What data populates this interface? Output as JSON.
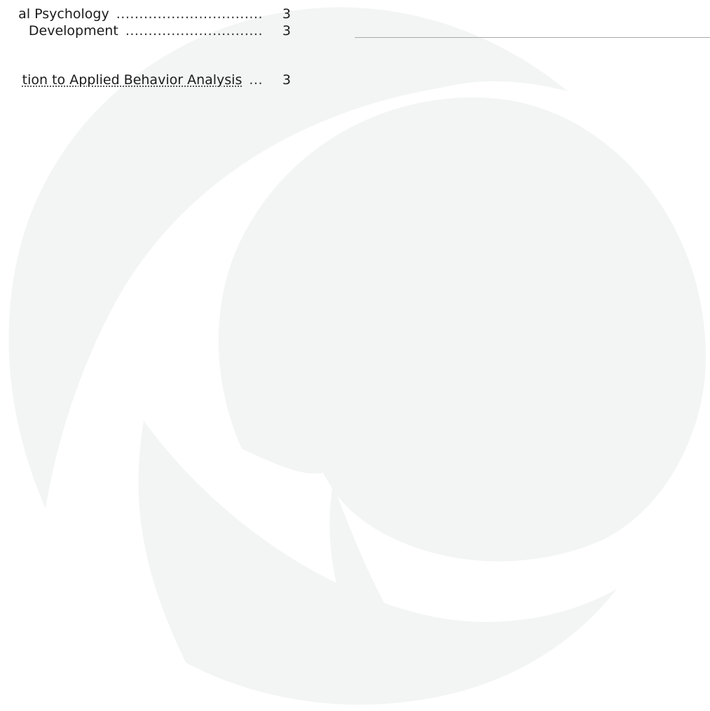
{
  "courses": [
    {
      "name": "al Psychology",
      "leader": "................................",
      "credits": "3"
    },
    {
      "name": " Development",
      "leader": "..............................",
      "credits": "3"
    },
    {
      "name": "tion to Applied Behavior Analysis",
      "leader": "...",
      "credits": "3"
    }
  ],
  "colors": {
    "text": "#1b1b1b",
    "rule": "#a9a9a9",
    "watermark": "#f3f5f5"
  },
  "watermark_icon": "swirl-logo-icon"
}
